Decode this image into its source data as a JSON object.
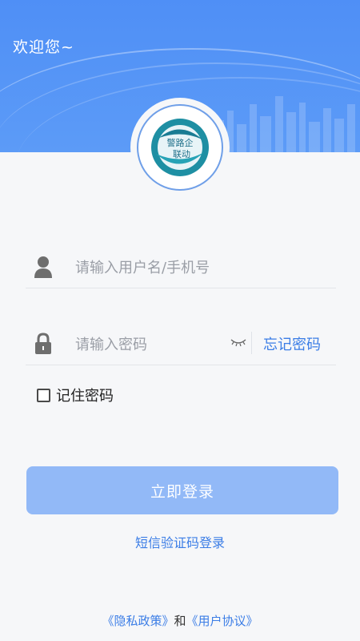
{
  "header": {
    "welcome": "欢迎您~"
  },
  "logo": {
    "text_top": "警路企",
    "text_bottom": "联动"
  },
  "username": {
    "placeholder": "请输入用户名/手机号"
  },
  "password": {
    "placeholder": "请输入密码",
    "forgot_label": "忘记密码"
  },
  "remember": {
    "label": "记住密码",
    "checked": false
  },
  "login_button": {
    "label": "立即登录"
  },
  "sms_login": {
    "label": "短信验证码登录"
  },
  "footer": {
    "privacy": "《隐私政策》",
    "connector": "和",
    "agreement": "《用户协议》"
  },
  "colors": {
    "primary": "#4f8ff6",
    "button": "#92b9f7",
    "link": "#3b7de6"
  }
}
